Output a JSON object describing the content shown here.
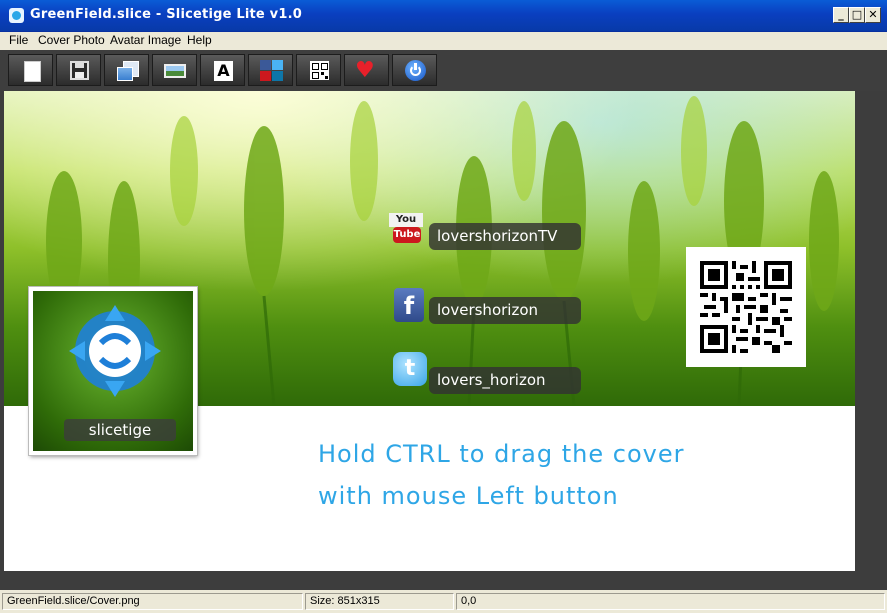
{
  "window": {
    "title": "GreenField.slice - Slicetige Lite v1.0",
    "controls": {
      "minimize": "_",
      "maximize": "□",
      "close": "✕"
    }
  },
  "menu": [
    "File",
    "Cover Photo",
    "Avatar Image",
    "Help"
  ],
  "toolbar": [
    {
      "name": "new-document-icon"
    },
    {
      "name": "save-icon"
    },
    {
      "name": "export-image-icon"
    },
    {
      "name": "cover-photo-icon"
    },
    {
      "name": "text-icon"
    },
    {
      "name": "social-icons-icon"
    },
    {
      "name": "qr-code-icon"
    },
    {
      "name": "heart-icon"
    },
    {
      "name": "power-icon"
    }
  ],
  "cover": {
    "avatar_name": "slicetige",
    "social": [
      {
        "icon": "youtube-icon",
        "label": "lovershorizonTV"
      },
      {
        "icon": "facebook-icon",
        "label": "lovershorizon"
      },
      {
        "icon": "twitter-icon",
        "label": "lovers_horizon"
      }
    ]
  },
  "hint": {
    "line1": "Hold CTRL to drag the cover",
    "line2": "with mouse Left button"
  },
  "status": {
    "file": "GreenField.slice/Cover.png",
    "size": "Size: 851x315",
    "coords": "0,0"
  },
  "colors": {
    "titlebar": "#0a4ecb",
    "toolbar": "#3e3e3e",
    "hint_text": "#2ea6e6",
    "youtube": "#cc181e",
    "facebook": "#3b5998",
    "twitter": "#4ab3f4"
  }
}
